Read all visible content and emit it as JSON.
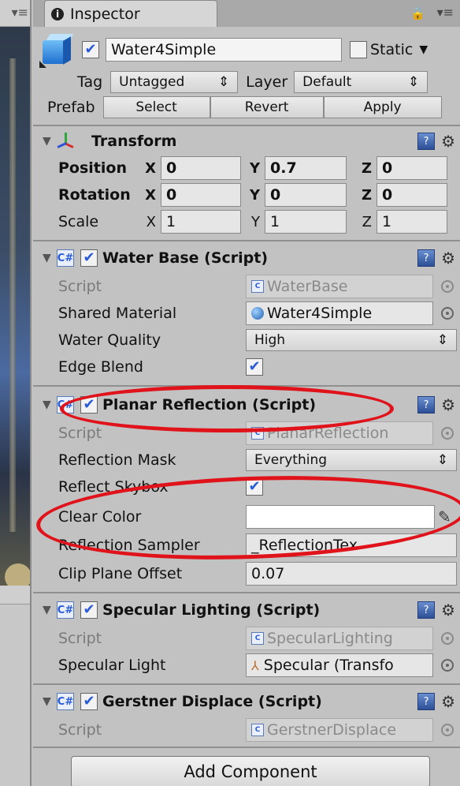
{
  "window": {
    "tab_title": "Inspector"
  },
  "object": {
    "name": "Water4Simple",
    "static_label": "Static",
    "tag_label": "Tag",
    "tag_value": "Untagged",
    "layer_label": "Layer",
    "layer_value": "Default",
    "prefab_label": "Prefab",
    "prefab_buttons": [
      "Select",
      "Revert",
      "Apply"
    ]
  },
  "transform": {
    "title": "Transform",
    "position_label": "Position",
    "position": [
      "0",
      "0.7",
      "0"
    ],
    "rotation_label": "Rotation",
    "rotation": [
      "0",
      "0",
      "0"
    ],
    "scale_label": "Scale",
    "scale": [
      "1",
      "1",
      "1"
    ],
    "axes": [
      "X",
      "Y",
      "Z"
    ]
  },
  "water_base": {
    "title": "Water Base (Script)",
    "script_label": "Script",
    "script_value": "WaterBase",
    "material_label": "Shared Material",
    "material_value": "Water4Simple",
    "quality_label": "Water Quality",
    "quality_value": "High",
    "edge_label": "Edge Blend"
  },
  "planar_reflection": {
    "title": "Planar Reflection (Script)",
    "script_label": "Script",
    "script_value": "PlanarReflection",
    "mask_label": "Reflection Mask",
    "mask_value": "Everything",
    "skybox_label": "Reflect Skybox",
    "clear_label": "Clear Color",
    "clear_color": "#ffffff",
    "sampler_label": "Reflection Sampler",
    "sampler_value": "_ReflectionTex",
    "offset_label": "Clip Plane Offset",
    "offset_value": "0.07"
  },
  "specular_lighting": {
    "title": "Specular Lighting (Script)",
    "script_label": "Script",
    "script_value": "SpecularLighting",
    "light_label": "Specular Light",
    "light_value": "Specular (Transfo"
  },
  "gerstner": {
    "title": "Gerstner Displace (Script)",
    "script_label": "Script",
    "script_value": "GerstnerDisplace"
  },
  "add_component_label": "Add Component",
  "colors": {
    "annotation": "#e0121a",
    "check": "#2a5bd7",
    "panel_bg": "#c2c2c2"
  }
}
